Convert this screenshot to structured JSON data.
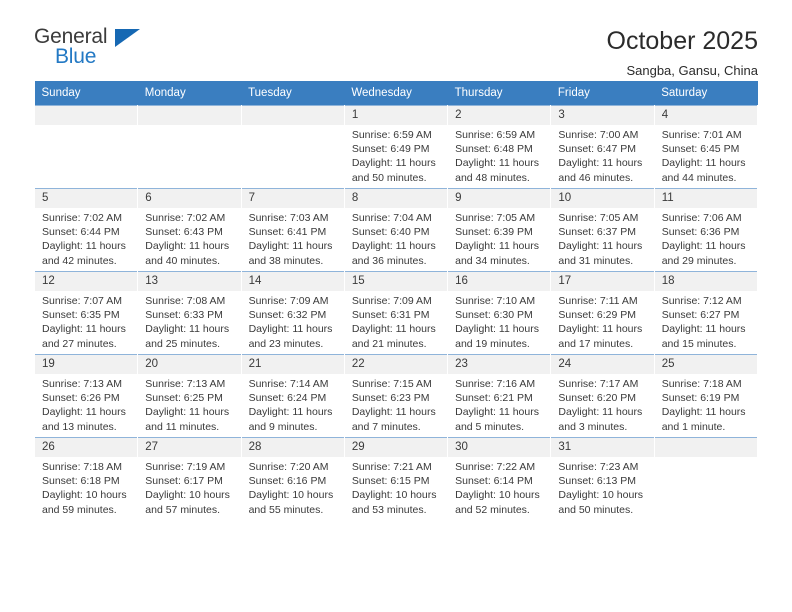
{
  "brand": {
    "name_top": "General",
    "name_bottom": "Blue",
    "triangle_color": "#1668b3",
    "blue_text_color": "#2379c4"
  },
  "header": {
    "title": "October 2025",
    "subtitle": "Sangba, Gansu, China"
  },
  "theme": {
    "header_row_bg": "#3a7ec0",
    "header_row_text": "#ffffff",
    "daynum_bg": "#f1f1f1",
    "grid_line": "#8fb4da",
    "body_text": "#3a3a3a"
  },
  "calendar": {
    "weekday_headers": [
      "Sunday",
      "Monday",
      "Tuesday",
      "Wednesday",
      "Thursday",
      "Friday",
      "Saturday"
    ],
    "weeks": [
      [
        {
          "day": "",
          "empty": true
        },
        {
          "day": "",
          "empty": true
        },
        {
          "day": "",
          "empty": true
        },
        {
          "day": "1",
          "sunrise": "Sunrise: 6:59 AM",
          "sunset": "Sunset: 6:49 PM",
          "daylight": "Daylight: 11 hours and 50 minutes."
        },
        {
          "day": "2",
          "sunrise": "Sunrise: 6:59 AM",
          "sunset": "Sunset: 6:48 PM",
          "daylight": "Daylight: 11 hours and 48 minutes."
        },
        {
          "day": "3",
          "sunrise": "Sunrise: 7:00 AM",
          "sunset": "Sunset: 6:47 PM",
          "daylight": "Daylight: 11 hours and 46 minutes."
        },
        {
          "day": "4",
          "sunrise": "Sunrise: 7:01 AM",
          "sunset": "Sunset: 6:45 PM",
          "daylight": "Daylight: 11 hours and 44 minutes."
        }
      ],
      [
        {
          "day": "5",
          "sunrise": "Sunrise: 7:02 AM",
          "sunset": "Sunset: 6:44 PM",
          "daylight": "Daylight: 11 hours and 42 minutes."
        },
        {
          "day": "6",
          "sunrise": "Sunrise: 7:02 AM",
          "sunset": "Sunset: 6:43 PM",
          "daylight": "Daylight: 11 hours and 40 minutes."
        },
        {
          "day": "7",
          "sunrise": "Sunrise: 7:03 AM",
          "sunset": "Sunset: 6:41 PM",
          "daylight": "Daylight: 11 hours and 38 minutes."
        },
        {
          "day": "8",
          "sunrise": "Sunrise: 7:04 AM",
          "sunset": "Sunset: 6:40 PM",
          "daylight": "Daylight: 11 hours and 36 minutes."
        },
        {
          "day": "9",
          "sunrise": "Sunrise: 7:05 AM",
          "sunset": "Sunset: 6:39 PM",
          "daylight": "Daylight: 11 hours and 34 minutes."
        },
        {
          "day": "10",
          "sunrise": "Sunrise: 7:05 AM",
          "sunset": "Sunset: 6:37 PM",
          "daylight": "Daylight: 11 hours and 31 minutes."
        },
        {
          "day": "11",
          "sunrise": "Sunrise: 7:06 AM",
          "sunset": "Sunset: 6:36 PM",
          "daylight": "Daylight: 11 hours and 29 minutes."
        }
      ],
      [
        {
          "day": "12",
          "sunrise": "Sunrise: 7:07 AM",
          "sunset": "Sunset: 6:35 PM",
          "daylight": "Daylight: 11 hours and 27 minutes."
        },
        {
          "day": "13",
          "sunrise": "Sunrise: 7:08 AM",
          "sunset": "Sunset: 6:33 PM",
          "daylight": "Daylight: 11 hours and 25 minutes."
        },
        {
          "day": "14",
          "sunrise": "Sunrise: 7:09 AM",
          "sunset": "Sunset: 6:32 PM",
          "daylight": "Daylight: 11 hours and 23 minutes."
        },
        {
          "day": "15",
          "sunrise": "Sunrise: 7:09 AM",
          "sunset": "Sunset: 6:31 PM",
          "daylight": "Daylight: 11 hours and 21 minutes."
        },
        {
          "day": "16",
          "sunrise": "Sunrise: 7:10 AM",
          "sunset": "Sunset: 6:30 PM",
          "daylight": "Daylight: 11 hours and 19 minutes."
        },
        {
          "day": "17",
          "sunrise": "Sunrise: 7:11 AM",
          "sunset": "Sunset: 6:29 PM",
          "daylight": "Daylight: 11 hours and 17 minutes."
        },
        {
          "day": "18",
          "sunrise": "Sunrise: 7:12 AM",
          "sunset": "Sunset: 6:27 PM",
          "daylight": "Daylight: 11 hours and 15 minutes."
        }
      ],
      [
        {
          "day": "19",
          "sunrise": "Sunrise: 7:13 AM",
          "sunset": "Sunset: 6:26 PM",
          "daylight": "Daylight: 11 hours and 13 minutes."
        },
        {
          "day": "20",
          "sunrise": "Sunrise: 7:13 AM",
          "sunset": "Sunset: 6:25 PM",
          "daylight": "Daylight: 11 hours and 11 minutes."
        },
        {
          "day": "21",
          "sunrise": "Sunrise: 7:14 AM",
          "sunset": "Sunset: 6:24 PM",
          "daylight": "Daylight: 11 hours and 9 minutes."
        },
        {
          "day": "22",
          "sunrise": "Sunrise: 7:15 AM",
          "sunset": "Sunset: 6:23 PM",
          "daylight": "Daylight: 11 hours and 7 minutes."
        },
        {
          "day": "23",
          "sunrise": "Sunrise: 7:16 AM",
          "sunset": "Sunset: 6:21 PM",
          "daylight": "Daylight: 11 hours and 5 minutes."
        },
        {
          "day": "24",
          "sunrise": "Sunrise: 7:17 AM",
          "sunset": "Sunset: 6:20 PM",
          "daylight": "Daylight: 11 hours and 3 minutes."
        },
        {
          "day": "25",
          "sunrise": "Sunrise: 7:18 AM",
          "sunset": "Sunset: 6:19 PM",
          "daylight": "Daylight: 11 hours and 1 minute."
        }
      ],
      [
        {
          "day": "26",
          "sunrise": "Sunrise: 7:18 AM",
          "sunset": "Sunset: 6:18 PM",
          "daylight": "Daylight: 10 hours and 59 minutes."
        },
        {
          "day": "27",
          "sunrise": "Sunrise: 7:19 AM",
          "sunset": "Sunset: 6:17 PM",
          "daylight": "Daylight: 10 hours and 57 minutes."
        },
        {
          "day": "28",
          "sunrise": "Sunrise: 7:20 AM",
          "sunset": "Sunset: 6:16 PM",
          "daylight": "Daylight: 10 hours and 55 minutes."
        },
        {
          "day": "29",
          "sunrise": "Sunrise: 7:21 AM",
          "sunset": "Sunset: 6:15 PM",
          "daylight": "Daylight: 10 hours and 53 minutes."
        },
        {
          "day": "30",
          "sunrise": "Sunrise: 7:22 AM",
          "sunset": "Sunset: 6:14 PM",
          "daylight": "Daylight: 10 hours and 52 minutes."
        },
        {
          "day": "31",
          "sunrise": "Sunrise: 7:23 AM",
          "sunset": "Sunset: 6:13 PM",
          "daylight": "Daylight: 10 hours and 50 minutes."
        },
        {
          "day": "",
          "empty": true
        }
      ]
    ]
  }
}
